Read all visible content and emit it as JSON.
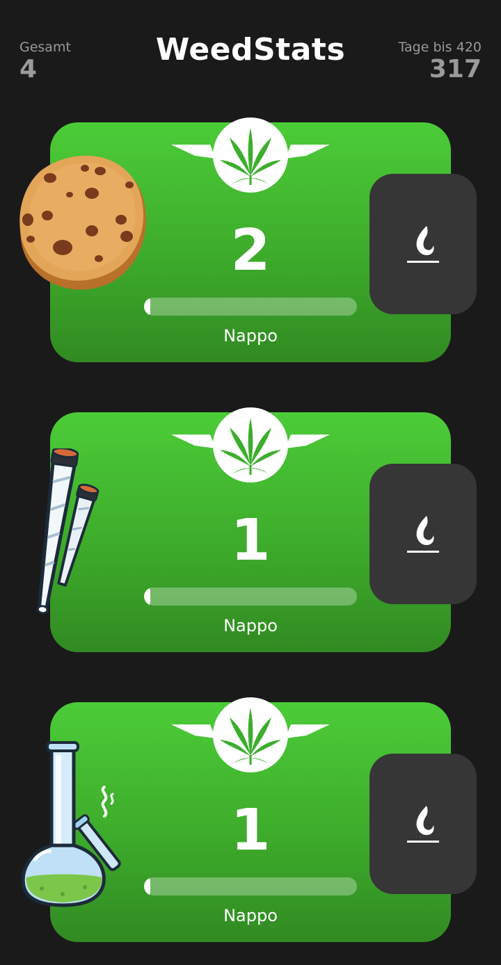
{
  "header": {
    "title": "WeedStats",
    "total_label": "Gesamt",
    "total_value": "4",
    "days_label": "Tage bis 420",
    "days_value": "317"
  },
  "cards": [
    {
      "illustration": "cookie-icon",
      "count": "2",
      "label": "Nappo",
      "progress": 0.02
    },
    {
      "illustration": "joints-icon",
      "count": "1",
      "label": "Nappo",
      "progress": 0.01
    },
    {
      "illustration": "bong-icon",
      "count": "1",
      "label": "Nappo",
      "progress": 0.01
    }
  ],
  "action_icon": "lighter-flame-icon",
  "colors": {
    "background": "#1a1a1a",
    "card_green": "#3fb52d",
    "button_dark": "#363636",
    "text_muted": "#9a9a9a"
  }
}
